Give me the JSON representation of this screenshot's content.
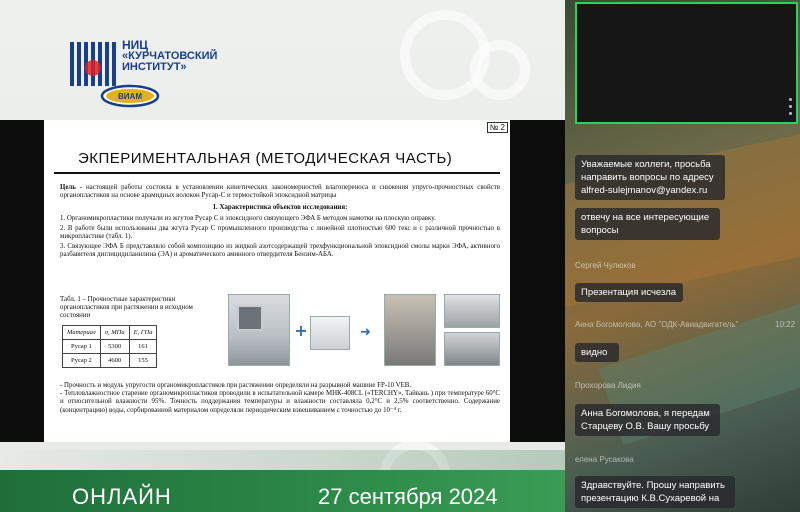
{
  "branding": {
    "org_line1": "НИЦ",
    "org_line2": "«КУРЧАТОВСКИЙ",
    "org_line3": "ИНСТИТУТ»",
    "seal_text": "ВИАМ",
    "colors": {
      "brand_blue": "#1a3f8c",
      "brand_green": "#2d8a48"
    }
  },
  "bottom_bar": {
    "label": "ОНЛАЙН",
    "date": "27 сентября 2024"
  },
  "slide": {
    "number": "№ 2",
    "title": "ЭКПЕРИМЕНТАЛЬНАЯ (МЕТОДИЧЕСКАЯ ЧАСТЬ)",
    "goal_label": "Цель",
    "goal_text": " - настоящей работы состояла в установлении кинетических закономерностей влагопереноса и снижения упруго-прочностных свойств органопластиков на основе арамидных волокон Русар-С и термостойкой эпоксидной матрицы",
    "section_title": "1. Характеристика объектов исследования:",
    "item1": "1. Органомикропластики получали из жгутов Русар С и эпоксидного связующего ЭФА Б методом намотки на плоскую оправку.",
    "item2": "2. В работе были использованы два жгута Русар С промышленного производства с линейной плотностью 600 текс и с различной прочностью в микропластике  (табл. 1).",
    "item3": "3. Связующее ЭФА Б представляло собой композицию из жидкой азотсодержащей трехфункциональной эпоксидной смолы марки ЭФА, активного разбавителя диглицидиланилина (ЭА) и ароматического аминного отвердителя Бензим-АБА.",
    "table_caption": "Табл. 1 – Прочностные характеристики органопластиков при растяжении в исходном состоянии",
    "table": {
      "headers": [
        "Материал",
        "σ, МПа",
        "E, ГПа"
      ],
      "rows": [
        [
          "Русар 1",
          "5300",
          "161"
        ],
        [
          "Русар 2",
          "4600",
          "155"
        ]
      ]
    },
    "footer1": "- Прочность и модуль упругости органомикропластиков при растяжении определяли на разрывной машине FP-10 VEB.",
    "footer2": "- Тепловлажностное старение органомикропластиков проводили в испытательной камере МНК-408CL («TERCHY», Тайвань ) при температуре 60°С и относительной влажности 95%. Точность поддержания температуры и влажности составляла 0,2°С и 2,5% соответственно. Содержание (концентрацию) воды, сорбированной материалом определяли периодическим взвешиванием с точностью до 10⁻⁴ г."
  },
  "chat": {
    "messages": [
      {
        "text": "Уважаемые коллеги, просьба направить вопросы по адресу alfred-sulejmanov@yandex.ru"
      },
      {
        "text": "отвечу на все интересующие вопросы"
      },
      {
        "sender": "Сергей Чулюков"
      },
      {
        "text": "Презентация исчезла"
      },
      {
        "sender": "Анна Богомолова, АО \"ОДК-Авиадвигатель\"",
        "time": "10:22"
      },
      {
        "text": "видно"
      },
      {
        "sender": "Прохорова Лидия"
      },
      {
        "text": "Анна Богомолова, я передам Старцеву О.В. Вашу просьбу"
      },
      {
        "sender": "елена Русакова"
      },
      {
        "text": "Здравствуйте. Прошу направить презентацию К.В.Сухаревой на"
      }
    ]
  }
}
